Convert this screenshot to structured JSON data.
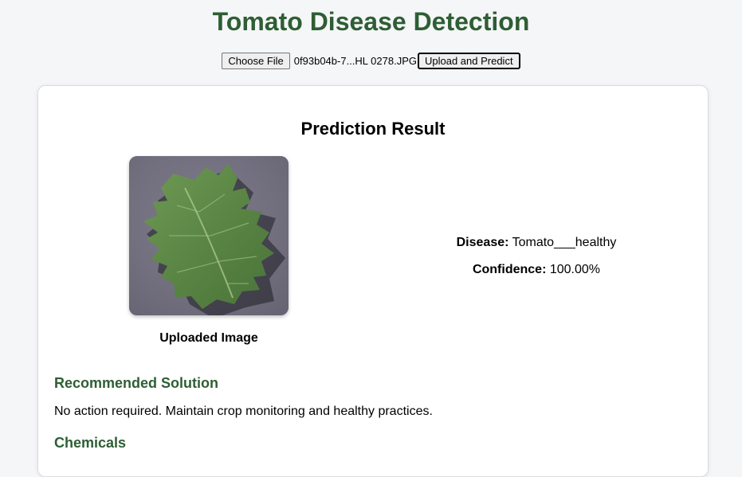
{
  "header": {
    "title": "Tomato Disease Detection"
  },
  "upload": {
    "choose_file_label": "Choose File",
    "file_name": "0f93b04b-7...HL 0278.JPG",
    "predict_label": "Upload and Predict"
  },
  "result": {
    "title": "Prediction Result",
    "image_caption": "Uploaded Image",
    "disease_label": "Disease:",
    "disease_value": "Tomato___healthy",
    "confidence_label": "Confidence:",
    "confidence_value": "100.00%"
  },
  "solution": {
    "heading": "Recommended Solution",
    "text": "No action required. Maintain crop monitoring and healthy practices."
  },
  "chemicals": {
    "heading": "Chemicals"
  },
  "colors": {
    "heading_green": "#2e5e34",
    "leaf_green": "#5a8a48",
    "background_gray": "#6e6c7a"
  }
}
